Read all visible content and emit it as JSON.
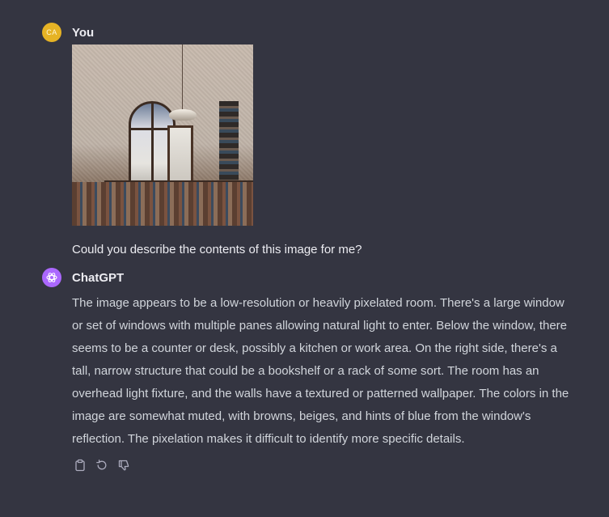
{
  "conversation": {
    "user_message": {
      "avatar_initials": "CA",
      "author": "You",
      "text": "Could you describe the contents of this image for me?"
    },
    "assistant_message": {
      "author": "ChatGPT",
      "text": "The image appears to be a low-resolution or heavily pixelated room. There's a large window or set of windows with multiple panes allowing natural light to enter. Below the window, there seems to be a counter or desk, possibly a kitchen or work area. On the right side, there's a tall, narrow structure that could be a bookshelf or a rack of some sort. The room has an overhead light fixture, and the walls have a textured or patterned wallpaper. The colors in the image are somewhat muted, with browns, beiges, and hints of blue from the window's reflection. The pixelation makes it difficult to identify more specific details.",
      "actions": [
        {
          "icon": "clipboard-icon"
        },
        {
          "icon": "regenerate-icon"
        },
        {
          "icon": "thumbs-down-icon"
        }
      ]
    }
  },
  "colors": {
    "background": "#343541",
    "user_avatar": "#e6b325",
    "assistant_avatar": "#ab68ff",
    "primary_text": "#ececf1",
    "secondary_text": "#d1d5db",
    "icon": "#acacbe"
  }
}
